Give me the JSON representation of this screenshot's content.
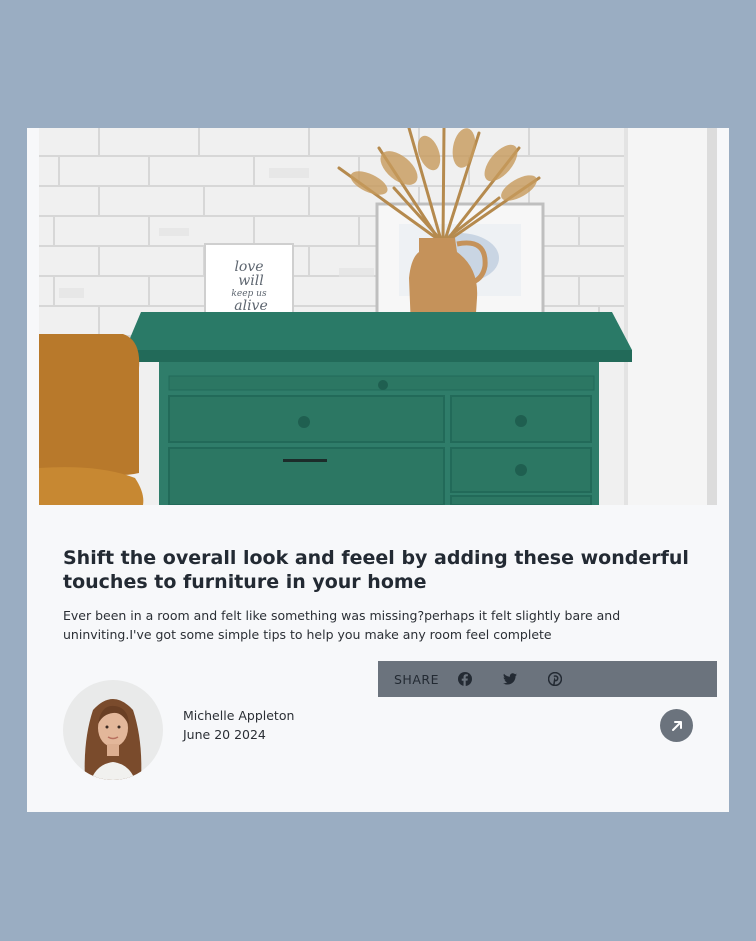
{
  "post": {
    "title": "Shift the overall look and feeel by adding these wonderful touches to furniture in your home",
    "description": "Ever been in a room and felt like something was missing?perhaps it felt slightly bare and uninviting.I've got some simple tips to help you make any room feel complete",
    "image_alt": "Green dresser with vase of dried grass and framed prints",
    "frame_text": [
      "love",
      "will",
      "keep us",
      "alive"
    ]
  },
  "share": {
    "label": "SHARE",
    "icons": [
      "facebook-icon",
      "twitter-icon",
      "pinterest-icon"
    ]
  },
  "author": {
    "name": "Michelle Appleton",
    "date": "June 20 2024"
  },
  "colors": {
    "background": "#9aadc2",
    "card": "#f7f8fa",
    "share_bar": "#6b737d",
    "title": "#232a33"
  }
}
